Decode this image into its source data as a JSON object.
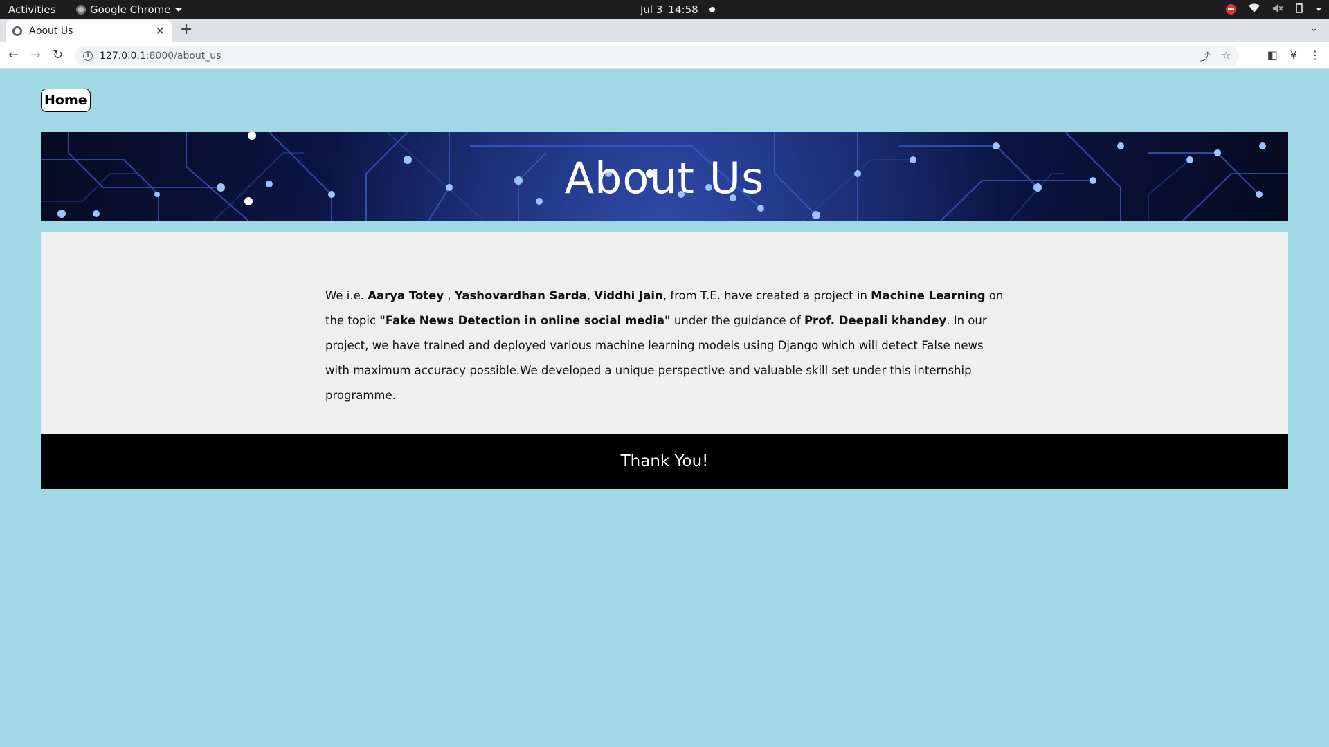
{
  "os_bar": {
    "activities": "Activities",
    "app_name": "Google Chrome",
    "date": "Jul 3",
    "time": "14:58"
  },
  "browser": {
    "tab_title": "About Us",
    "url_host": "127.0.0.1",
    "url_path": ":8000/about_us"
  },
  "page": {
    "home_button": "Home",
    "banner_title": "About Us",
    "about": {
      "t1": "We i.e. ",
      "b1": "Aarya Totey",
      "t2": " , ",
      "b2": "Yashovardhan Sarda",
      "t3": ", ",
      "b3": "Viddhi Jain",
      "t4": ", from T.E. have created a project in ",
      "b4": "Machine Learning",
      "t5": " on the topic ",
      "b5": "\"Fake News Detection in online social media\"",
      "t6": " under the guidance of ",
      "b6": "Prof. Deepali khandey",
      "t7": ". In our project, we have trained and deployed various machine learning models using Django which will detect False news with maximum accuracy possible.We developed a unique perspective and valuable skill set under this internship programme."
    },
    "footer_text": "Thank You!"
  },
  "colors": {
    "page_background": "#a0d9e5",
    "content_background": "#efefef",
    "footer_background": "#000000",
    "banner_dark_blue": "#0e1a55"
  }
}
